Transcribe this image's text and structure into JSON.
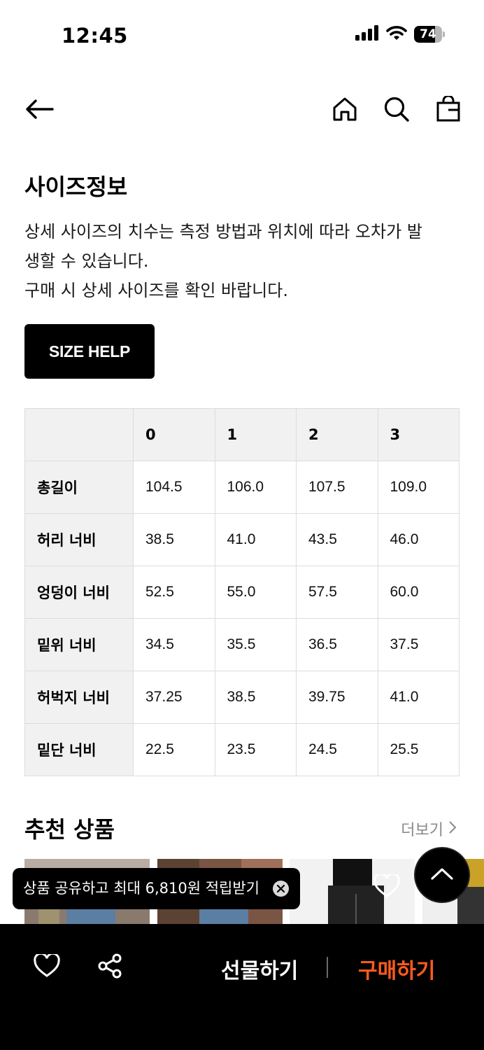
{
  "status_bar": {
    "time": "12:45",
    "battery": "74",
    "battery_level": 0.74
  },
  "page": {
    "title": "사이즈정보",
    "description_lines": [
      "상세 사이즈의 치수는 측정 방법과 위치에 따라 오차가 발",
      "생할 수 있습니다.",
      "구매 시 상세 사이즈를 확인 바랍니다."
    ],
    "size_help_label": "SIZE HELP"
  },
  "size_table": {
    "headers": [
      "",
      "0",
      "1",
      "2",
      "3"
    ],
    "rows": [
      {
        "label": "총길이",
        "values": [
          "104.5",
          "106.0",
          "107.5",
          "109.0"
        ]
      },
      {
        "label": "허리 너비",
        "values": [
          "38.5",
          "41.0",
          "43.5",
          "46.0"
        ]
      },
      {
        "label": "엉덩이 너비",
        "values": [
          "52.5",
          "55.0",
          "57.5",
          "60.0"
        ]
      },
      {
        "label": "밑위 너비",
        "values": [
          "34.5",
          "35.5",
          "36.5",
          "37.5"
        ]
      },
      {
        "label": "허벅지 너비",
        "values": [
          "37.25",
          "38.5",
          "39.75",
          "41.0"
        ]
      },
      {
        "label": "밑단 너비",
        "values": [
          "22.5",
          "23.5",
          "24.5",
          "25.5"
        ]
      }
    ]
  },
  "recommended": {
    "title": "추천 상품",
    "more_label": "더보기"
  },
  "toast": {
    "text": "상품 공유하고 최대 6,810원 적립받기"
  },
  "bottom_bar": {
    "gift_label": "선물하기",
    "buy_label": "구매하기"
  },
  "colors": {
    "accent": "#ff5a1f",
    "bar_bg": "#000000"
  },
  "icons": [
    "back-arrow-icon",
    "home-icon",
    "search-icon",
    "shopping-bag-icon",
    "chevron-right-icon",
    "close-icon",
    "chevron-up-icon",
    "heart-icon",
    "share-icon"
  ]
}
